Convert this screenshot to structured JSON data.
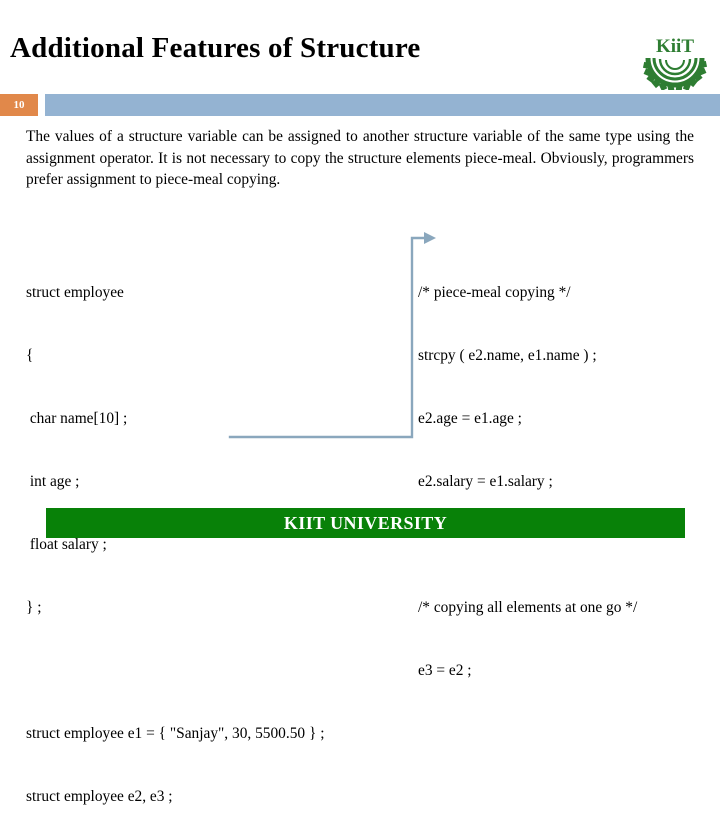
{
  "slide": {
    "title": "Additional Features of Structure",
    "number": "10",
    "colors": {
      "badge_orange": "#e1884a",
      "header_blue": "#94b3d2",
      "footer_green": "#088108",
      "logo_green": "#2e7d32",
      "connector_blue": "#8aa7bd",
      "text_black": "#000000"
    }
  },
  "logo": {
    "name": "kiit-logo",
    "wordmark": "KiiT"
  },
  "body": {
    "paragraph": "The values of a structure variable can be assigned to another structure variable of the same type using the assignment operator. It is not necessary to copy the structure elements piece-meal. Obviously, programmers prefer assignment to piece-meal copying."
  },
  "code_left": {
    "lines": [
      "struct employee",
      "{",
      " char name[10] ;",
      " int age ;",
      " float salary ;",
      "} ;",
      "",
      "struct employee e1 = { \"Sanjay\", 30, 5500.50 } ;",
      "struct employee e2, e3 ;"
    ]
  },
  "code_right": {
    "lines": [
      "/* piece-meal copying */",
      "strcpy ( e2.name, e1.name ) ;",
      "e2.age = e1.age ;",
      "e2.salary = e1.salary ;",
      "",
      "/* copying all elements at one go */",
      "e3 = e2 ;"
    ]
  },
  "footer": {
    "label": "KIIT UNIVERSITY"
  }
}
